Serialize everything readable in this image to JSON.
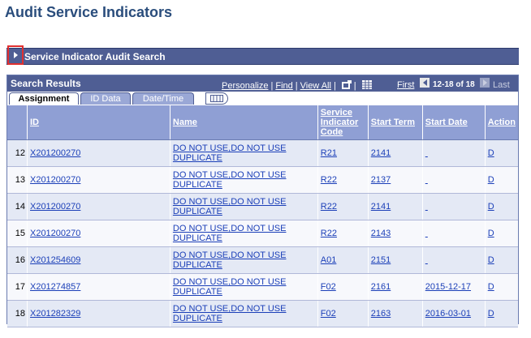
{
  "page": {
    "title": "Audit Service Indicators"
  },
  "section": {
    "label": "Service Indicator Audit Search"
  },
  "grid": {
    "title": "Search Results",
    "links": {
      "personalize": "Personalize",
      "find": "Find",
      "view_all": "View All"
    },
    "nav": {
      "first": "First",
      "range": "12-18 of 18",
      "last": "Last"
    },
    "tabs": [
      "Assignment",
      "ID Data",
      "Date/Time"
    ],
    "columns": {
      "id": "ID",
      "name": "Name",
      "code_l1": "Service",
      "code_l2": "Indicator",
      "code_l3": "Code",
      "start_term": "Start Term",
      "start_date": "Start Date",
      "action": "Action"
    },
    "rows": [
      {
        "num": "12",
        "id": "X201200270",
        "name_l1": "DO NOT USE,DO NOT USE",
        "name_l2": "DUPLICATE",
        "code": "R21",
        "term": "2141",
        "date": "",
        "action": "D"
      },
      {
        "num": "13",
        "id": "X201200270",
        "name_l1": "DO NOT USE,DO NOT USE",
        "name_l2": "DUPLICATE",
        "code": "R22",
        "term": "2137",
        "date": "",
        "action": "D"
      },
      {
        "num": "14",
        "id": "X201200270",
        "name_l1": "DO NOT USE,DO NOT USE",
        "name_l2": "DUPLICATE",
        "code": "R22",
        "term": "2141",
        "date": "",
        "action": "D"
      },
      {
        "num": "15",
        "id": "X201200270",
        "name_l1": "DO NOT USE,DO NOT USE",
        "name_l2": "DUPLICATE",
        "code": "R22",
        "term": "2143",
        "date": "",
        "action": "D"
      },
      {
        "num": "16",
        "id": "X201254609",
        "name_l1": "DO NOT USE,DO NOT USE",
        "name_l2": "DUPLICATE",
        "code": "A01",
        "term": "2151",
        "date": "",
        "action": "D"
      },
      {
        "num": "17",
        "id": "X201274857",
        "name_l1": "DO NOT USE,DO NOT USE",
        "name_l2": "DUPLICATE",
        "code": "F02",
        "term": "2161",
        "date": "2015-12-17",
        "action": "D"
      },
      {
        "num": "18",
        "id": "X201282329",
        "name_l1": "DO NOT USE,DO NOT USE",
        "name_l2": "DUPLICATE",
        "code": "F02",
        "term": "2163",
        "date": "2016-03-01",
        "action": "D"
      }
    ]
  },
  "colors": {
    "header_bar": "#4f5e94",
    "column_header": "#8f9fd4",
    "link": "#1b3fb8",
    "title": "#2a4d7c",
    "highlight_box": "#e03030"
  }
}
